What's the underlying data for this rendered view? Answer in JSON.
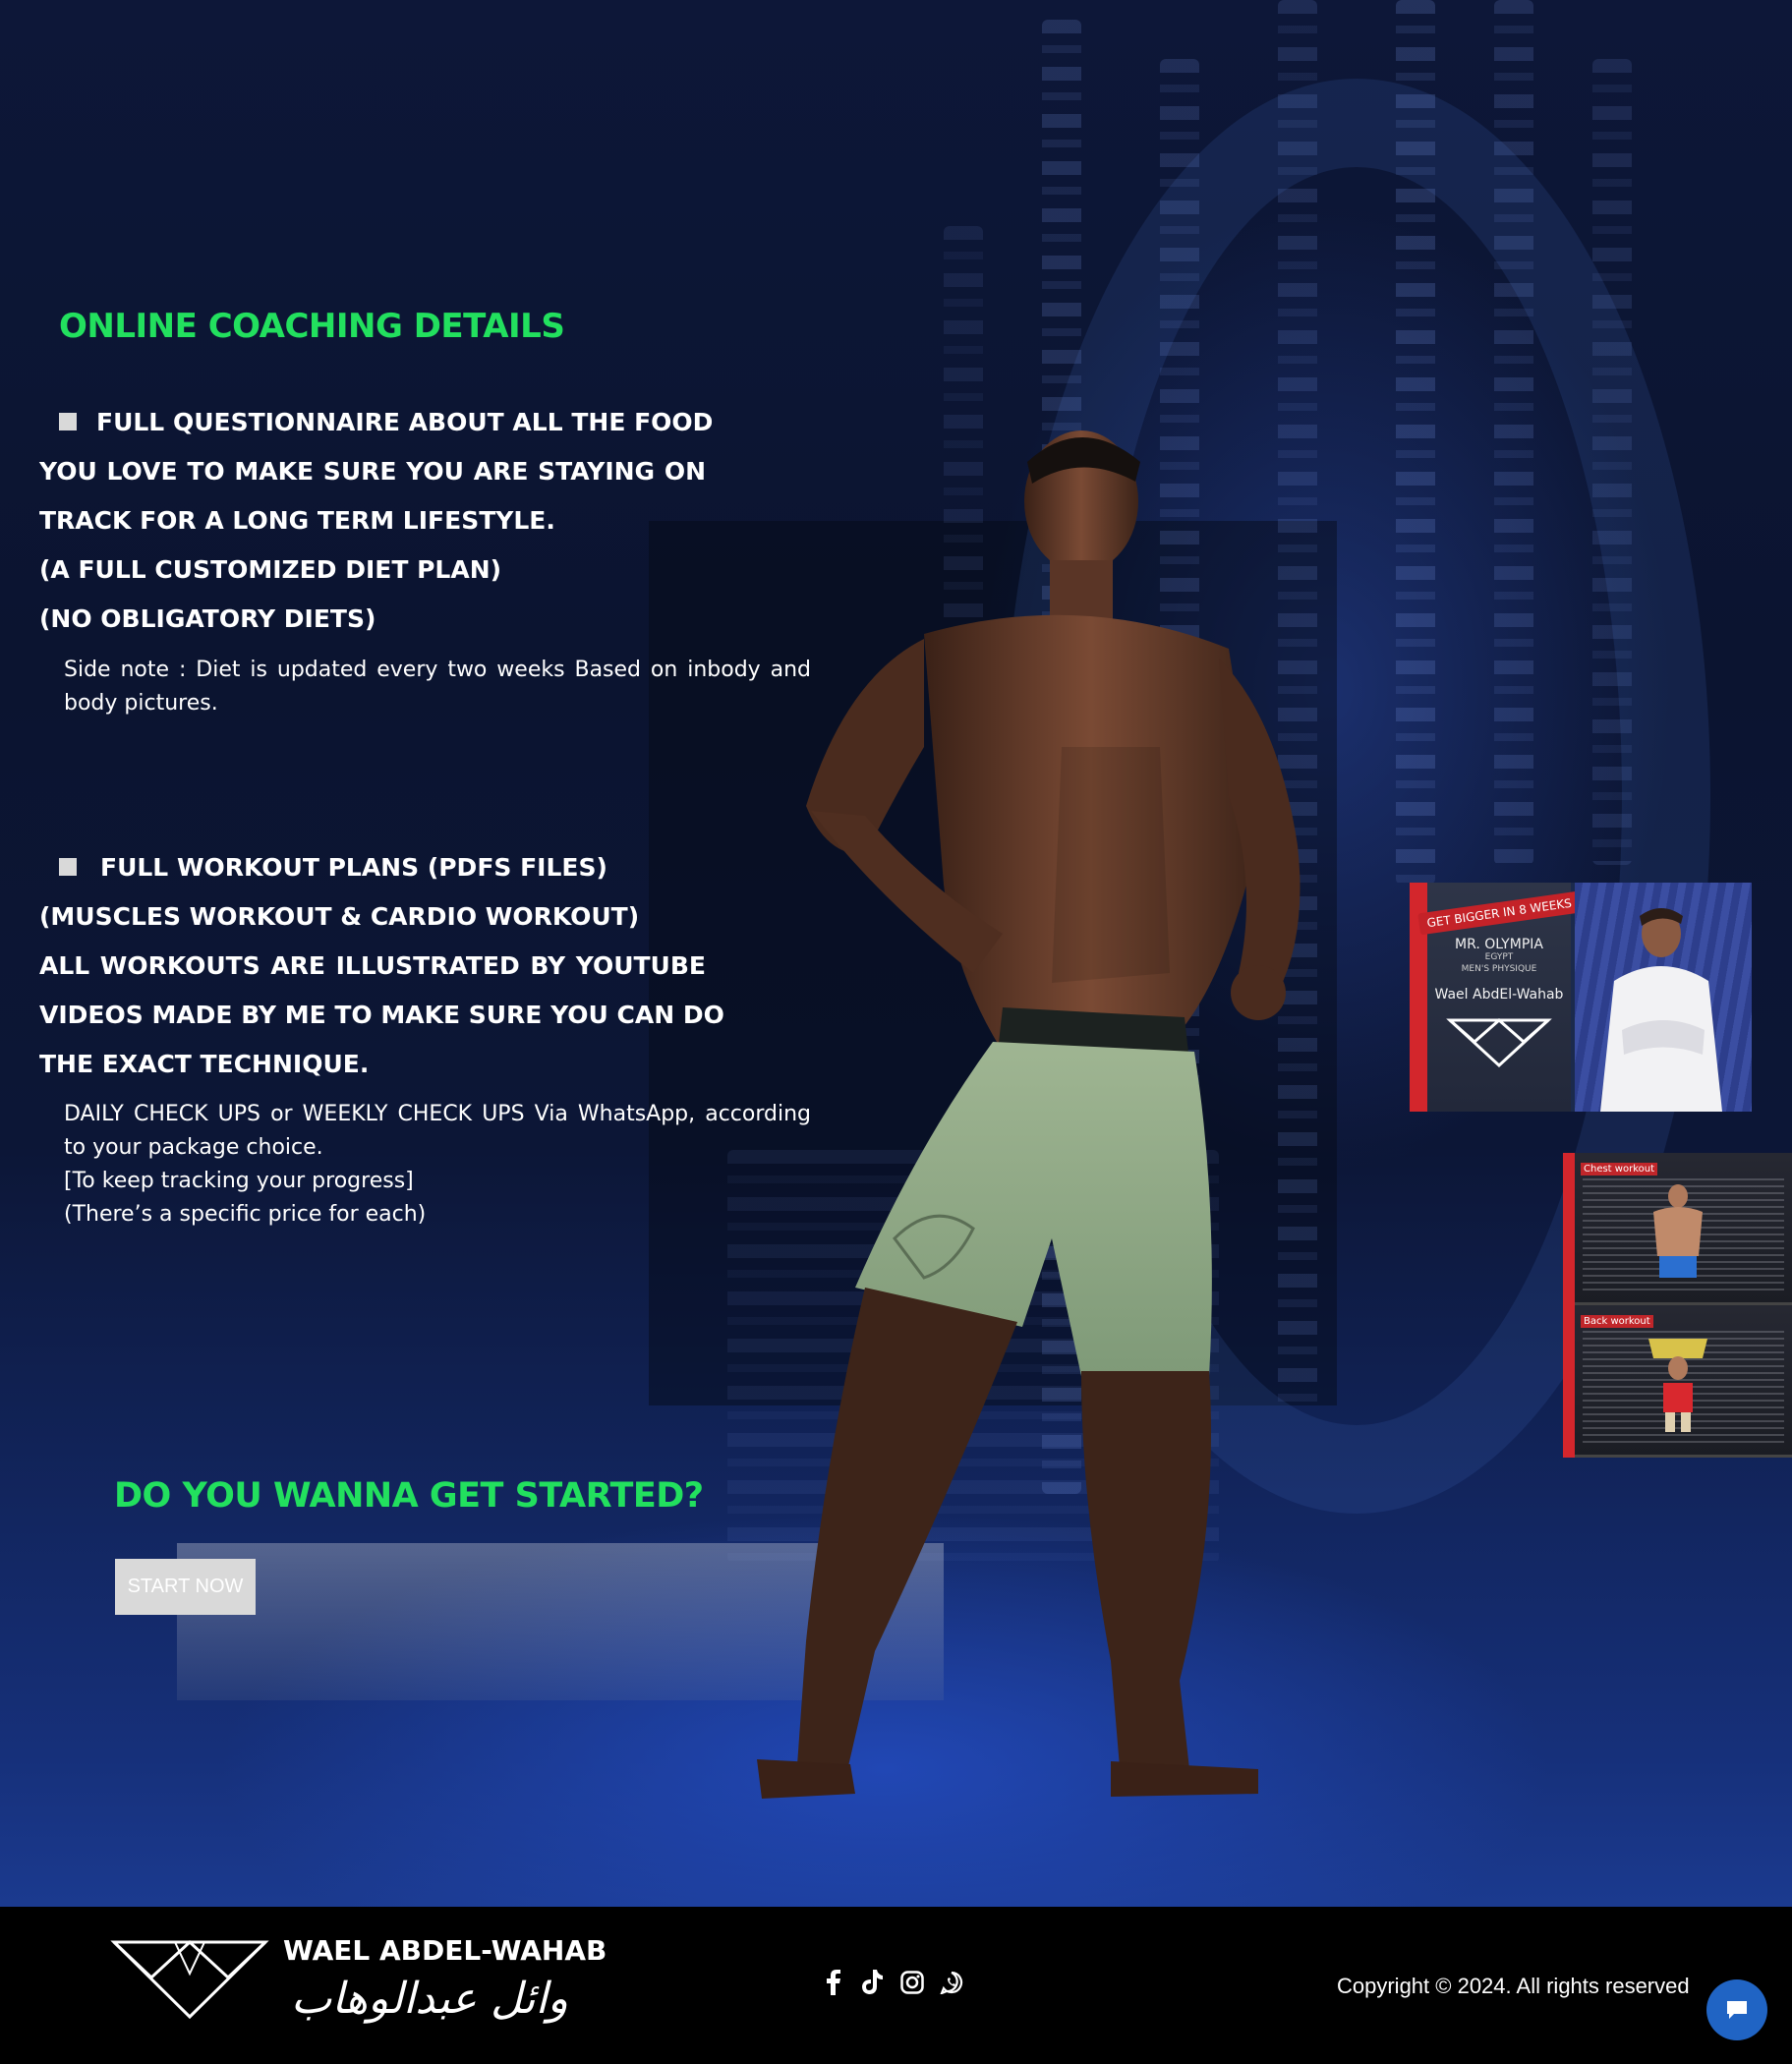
{
  "coaching": {
    "title": "ONLINE COACHING DETAILS",
    "item1": {
      "lines": [
        "FULL QUESTIONNAIRE ABOUT ALL THE FOOD",
        "YOU LOVE TO MAKE SURE YOU ARE STAYING ON",
        "TRACK FOR A LONG TERM LIFESTYLE.",
        "(A FULL CUSTOMIZED DIET PLAN)",
        "(NO OBLIGATORY DIETS)"
      ],
      "note": [
        "Side note : Diet is updated every two weeks Based on inbody and",
        "body pictures."
      ]
    },
    "item2": {
      "lines": [
        "FULL WORKOUT PLANS (PDFS FILES)",
        "(MUSCLES WORKOUT & CARDIO WORKOUT)",
        "ALL WORKOUTS ARE ILLUSTRATED BY YOUTUBE",
        "VIDEOS MADE BY ME TO MAKE SURE YOU CAN DO",
        "THE EXACT TECHNIQUE."
      ],
      "note": [
        "DAILY CHECK UPS or WEEKLY CHECK UPS Via WhatsApp, according",
        "to your package choice.",
        "[To keep tracking your progress]",
        "(There’s a specific price for each)"
      ]
    }
  },
  "cta": {
    "title": "DO YOU WANNA GET STARTED?",
    "button_label": "START NOW"
  },
  "book_cover": {
    "ribbon": "GET BIGGER IN 8 WEEKS",
    "title": "MR. OLYMPIA",
    "sub1": "EGYPT",
    "sub2": "MEN'S PHYSIQUE",
    "author": "Wael AbdEl-Wahab"
  },
  "workout_preview": {
    "panel1": "Chest workout",
    "panel2": "Back workout"
  },
  "footer": {
    "brand_name": "WAEL ABDEL-WAHAB",
    "brand_arabic": "وائل عبدالوهاب",
    "socials": [
      "facebook-icon",
      "tiktok-icon",
      "instagram-icon",
      "whatsapp-icon"
    ],
    "copyright": "Copyright © 2024. All rights reserved"
  },
  "colors": {
    "accent_green": "#22e05e",
    "button_bg": "#d9d9d9",
    "footer_bg": "#000000",
    "chat_bubble": "#2064c4",
    "cover_red": "#d3262c"
  }
}
